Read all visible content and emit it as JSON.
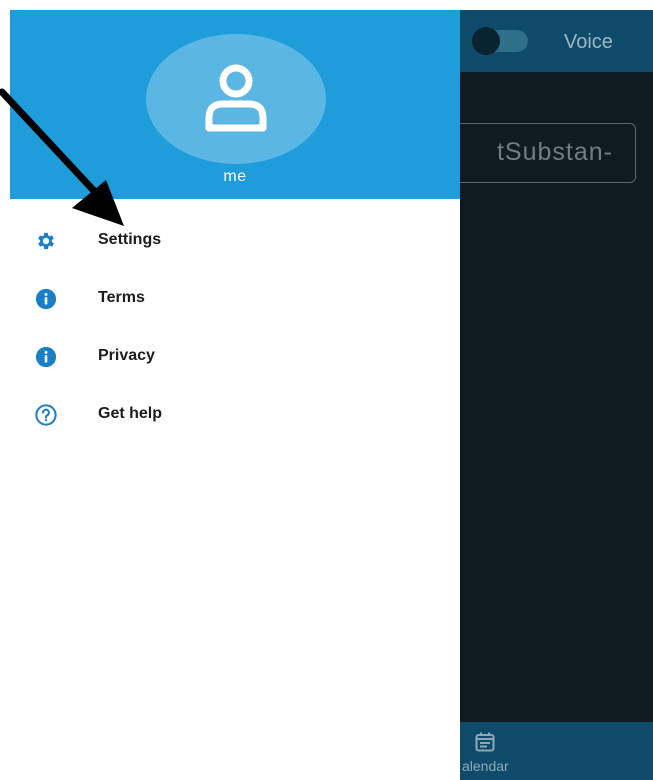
{
  "background_app": {
    "voice_label": "Voice",
    "text_field_value": "tSubstan-",
    "bottom_nav": {
      "calendar_label": "alendar",
      "calendar_icon": "calendar-icon"
    }
  },
  "drawer": {
    "avatar_icon": "person-icon",
    "user_name": "me",
    "items": [
      {
        "label": "Settings",
        "icon": "gear-icon"
      },
      {
        "label": "Terms",
        "icon": "info-icon"
      },
      {
        "label": "Privacy",
        "icon": "info-icon"
      },
      {
        "label": "Get help",
        "icon": "help-icon"
      }
    ]
  },
  "colors": {
    "header": "#1f9ddb",
    "icon_blue": "#1a7fc6",
    "background_app_bar": "#0e4a6a",
    "annotation_arrow": "#000000"
  }
}
